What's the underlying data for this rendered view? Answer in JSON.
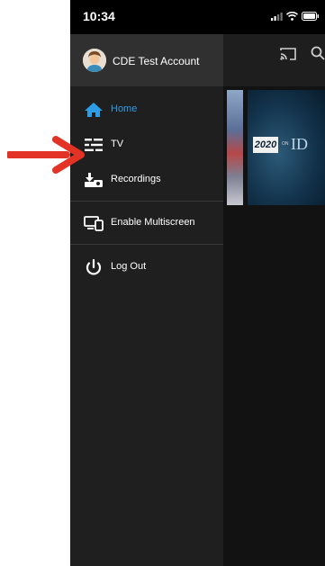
{
  "status_bar": {
    "time": "10:34"
  },
  "account": {
    "name": "CDE Test Account"
  },
  "menu": [
    {
      "label": "Home",
      "icon": "home-icon",
      "active": true
    },
    {
      "label": "TV",
      "icon": "tv-guide-icon",
      "active": false
    },
    {
      "label": "Recordings",
      "icon": "recordings-icon",
      "active": false
    },
    {
      "label": "Enable Multiscreen",
      "icon": "multiscreen-icon",
      "active": false
    },
    {
      "label": "Log Out",
      "icon": "power-icon",
      "active": false
    }
  ],
  "background": {
    "tile_2020": "2020",
    "tile_on": "ON",
    "tile_id": "ID"
  },
  "colors": {
    "accent": "#2d9de6",
    "drawer_bg": "#1f1f1f",
    "header_bg": "#303030",
    "annotation_arrow": "#e33326"
  }
}
